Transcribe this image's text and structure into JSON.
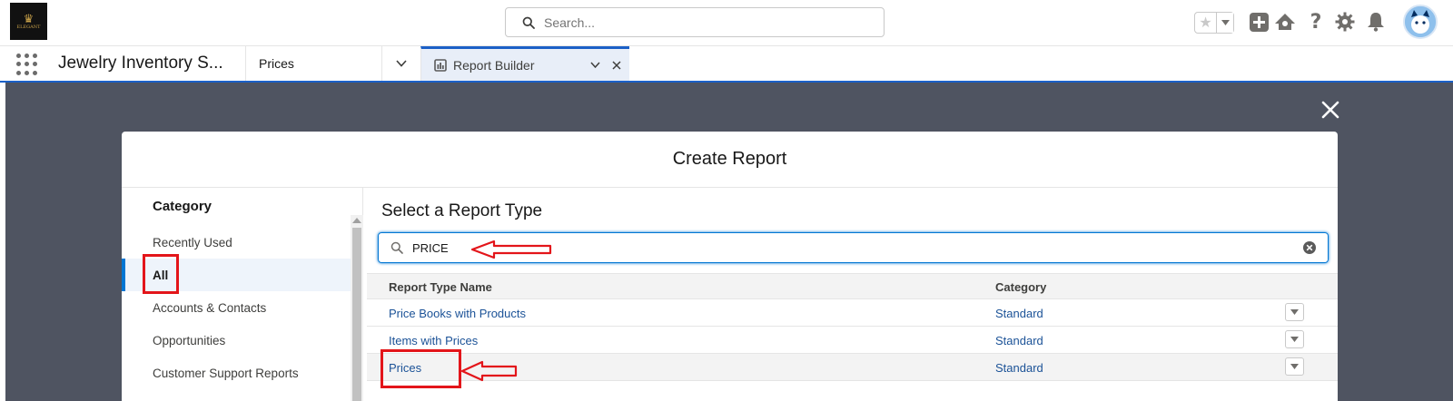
{
  "header": {
    "logo_text": "ELEGANT",
    "search_placeholder": "Search...",
    "icons": [
      "favorites-star-icon",
      "chevron-down-icon",
      "add-icon",
      "trailhead-icon",
      "help-icon",
      "setup-gear-icon",
      "notifications-bell-icon",
      "avatar"
    ]
  },
  "nav": {
    "app_name": "Jewelry Inventory S...",
    "items": [
      {
        "label": "Prices"
      },
      {
        "label": "Report Builder",
        "icon": "report-icon",
        "active": true
      }
    ]
  },
  "modal": {
    "title": "Create Report",
    "category_heading": "Category",
    "categories": [
      {
        "label": "Recently Used"
      },
      {
        "label": "All",
        "selected": true
      },
      {
        "label": "Accounts & Contacts"
      },
      {
        "label": "Opportunities"
      },
      {
        "label": "Customer Support Reports"
      }
    ],
    "panel_title": "Select a Report Type",
    "search_value": "PRICE",
    "columns": {
      "name": "Report Type Name",
      "category": "Category"
    },
    "rows": [
      {
        "name": "Price Books with Products",
        "category": "Standard"
      },
      {
        "name": "Items with Prices",
        "category": "Standard"
      },
      {
        "name": "Prices",
        "category": "Standard",
        "highlighted": true
      }
    ]
  },
  "colors": {
    "brand_blue": "#0176d3",
    "link_blue": "#1b5297",
    "backdrop": "#4f5461",
    "annotation_red": "#e3151a"
  }
}
